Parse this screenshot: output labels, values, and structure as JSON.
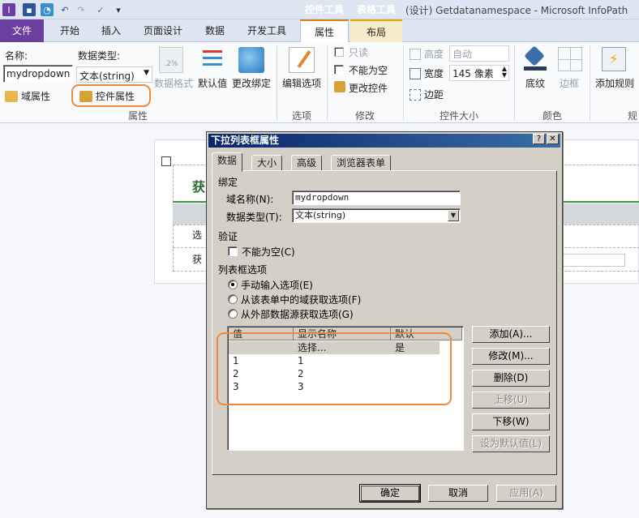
{
  "window": {
    "title": "(设计) Getdatanamespace - Microsoft InfoPath",
    "context_tab_groups": [
      {
        "label": "控件工具",
        "color": "#e07a1a"
      },
      {
        "label": "表格工具",
        "color": "#e6a800"
      }
    ]
  },
  "tabs": [
    "文件",
    "开始",
    "插入",
    "页面设计",
    "数据",
    "开发工具",
    "属性",
    "布局"
  ],
  "ribbon": {
    "name_label": "名称:",
    "name_value": "mydropdown",
    "datatype_label": "数据类型:",
    "datatype_value": "文本(string)",
    "field_props": "域属性",
    "control_props": "控件属性",
    "data_format": "数据格式",
    "default_value": "默认值",
    "change_binding": "更改绑定",
    "edit_options": "编辑选项",
    "readonly": "只读",
    "not_blank": "不能为空",
    "change_control": "更改控件",
    "height_label": "高度",
    "height_value": "自动",
    "width_label": "宽度",
    "width_value": "145 像素",
    "margins": "边距",
    "shading": "底纹",
    "borders": "边框",
    "add_rule": "添加规则",
    "groups": {
      "properties": "属性",
      "options": "选项",
      "modify": "修改",
      "control_size": "控件大小",
      "color": "颜色",
      "rules": "规"
    }
  },
  "doc": {
    "heading": "获",
    "row1": "选",
    "row2": "获"
  },
  "dialog": {
    "title": "下拉列表框属性",
    "help": "?",
    "close": "✕",
    "tabs": [
      "数据",
      "大小",
      "高级",
      "浏览器表单"
    ],
    "binding_section": "绑定",
    "field_name_label": "域名称(N):",
    "field_name_value": "mydropdown",
    "data_type_label": "数据类型(T):",
    "data_type_value": "文本(string)",
    "validation_section": "验证",
    "cannot_be_blank": "不能为空(C)",
    "list_options_section": "列表框选项",
    "radio_manual": "手动输入选项(E)",
    "radio_form": "从该表单中的域获取选项(F)",
    "radio_external": "从外部数据源获取选项(G)",
    "columns": [
      "值",
      "显示名称",
      "默认"
    ],
    "rows": [
      {
        "value": "",
        "display": "选择...",
        "default": "是"
      },
      {
        "value": "1",
        "display": "1",
        "default": ""
      },
      {
        "value": "2",
        "display": "2",
        "default": ""
      },
      {
        "value": "3",
        "display": "3",
        "default": ""
      }
    ],
    "btn_add": "添加(A)...",
    "btn_modify": "修改(M)...",
    "btn_delete": "删除(D)",
    "btn_move_up": "上移(U)",
    "btn_move_down": "下移(W)",
    "btn_set_default": "设为默认值(L)",
    "btn_ok": "确定",
    "btn_cancel": "取消",
    "btn_apply": "应用(A)"
  }
}
